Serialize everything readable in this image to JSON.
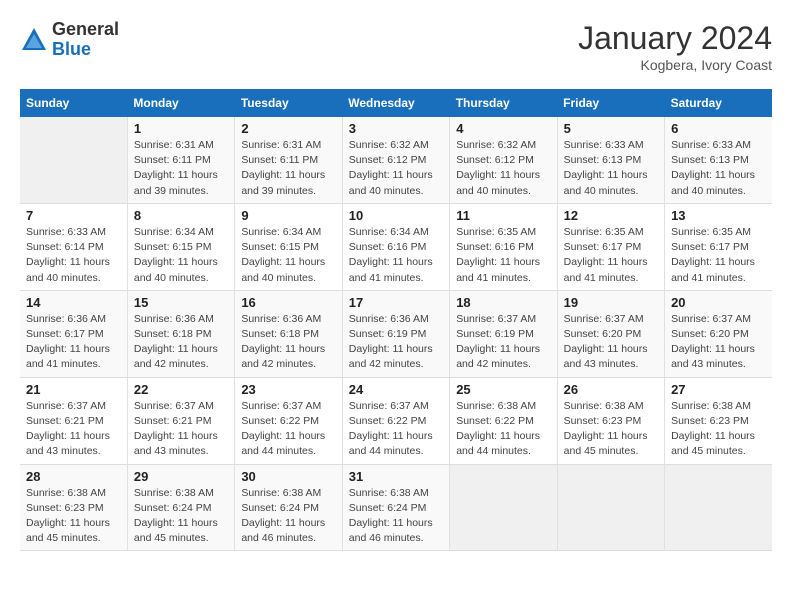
{
  "logo": {
    "general": "General",
    "blue": "Blue"
  },
  "title": "January 2024",
  "location": "Kogbera, Ivory Coast",
  "days_header": [
    "Sunday",
    "Monday",
    "Tuesday",
    "Wednesday",
    "Thursday",
    "Friday",
    "Saturday"
  ],
  "weeks": [
    [
      {
        "num": "",
        "sunrise": "",
        "sunset": "",
        "daylight": ""
      },
      {
        "num": "1",
        "sunrise": "Sunrise: 6:31 AM",
        "sunset": "Sunset: 6:11 PM",
        "daylight": "Daylight: 11 hours and 39 minutes."
      },
      {
        "num": "2",
        "sunrise": "Sunrise: 6:31 AM",
        "sunset": "Sunset: 6:11 PM",
        "daylight": "Daylight: 11 hours and 39 minutes."
      },
      {
        "num": "3",
        "sunrise": "Sunrise: 6:32 AM",
        "sunset": "Sunset: 6:12 PM",
        "daylight": "Daylight: 11 hours and 40 minutes."
      },
      {
        "num": "4",
        "sunrise": "Sunrise: 6:32 AM",
        "sunset": "Sunset: 6:12 PM",
        "daylight": "Daylight: 11 hours and 40 minutes."
      },
      {
        "num": "5",
        "sunrise": "Sunrise: 6:33 AM",
        "sunset": "Sunset: 6:13 PM",
        "daylight": "Daylight: 11 hours and 40 minutes."
      },
      {
        "num": "6",
        "sunrise": "Sunrise: 6:33 AM",
        "sunset": "Sunset: 6:13 PM",
        "daylight": "Daylight: 11 hours and 40 minutes."
      }
    ],
    [
      {
        "num": "7",
        "sunrise": "Sunrise: 6:33 AM",
        "sunset": "Sunset: 6:14 PM",
        "daylight": "Daylight: 11 hours and 40 minutes."
      },
      {
        "num": "8",
        "sunrise": "Sunrise: 6:34 AM",
        "sunset": "Sunset: 6:15 PM",
        "daylight": "Daylight: 11 hours and 40 minutes."
      },
      {
        "num": "9",
        "sunrise": "Sunrise: 6:34 AM",
        "sunset": "Sunset: 6:15 PM",
        "daylight": "Daylight: 11 hours and 40 minutes."
      },
      {
        "num": "10",
        "sunrise": "Sunrise: 6:34 AM",
        "sunset": "Sunset: 6:16 PM",
        "daylight": "Daylight: 11 hours and 41 minutes."
      },
      {
        "num": "11",
        "sunrise": "Sunrise: 6:35 AM",
        "sunset": "Sunset: 6:16 PM",
        "daylight": "Daylight: 11 hours and 41 minutes."
      },
      {
        "num": "12",
        "sunrise": "Sunrise: 6:35 AM",
        "sunset": "Sunset: 6:17 PM",
        "daylight": "Daylight: 11 hours and 41 minutes."
      },
      {
        "num": "13",
        "sunrise": "Sunrise: 6:35 AM",
        "sunset": "Sunset: 6:17 PM",
        "daylight": "Daylight: 11 hours and 41 minutes."
      }
    ],
    [
      {
        "num": "14",
        "sunrise": "Sunrise: 6:36 AM",
        "sunset": "Sunset: 6:17 PM",
        "daylight": "Daylight: 11 hours and 41 minutes."
      },
      {
        "num": "15",
        "sunrise": "Sunrise: 6:36 AM",
        "sunset": "Sunset: 6:18 PM",
        "daylight": "Daylight: 11 hours and 42 minutes."
      },
      {
        "num": "16",
        "sunrise": "Sunrise: 6:36 AM",
        "sunset": "Sunset: 6:18 PM",
        "daylight": "Daylight: 11 hours and 42 minutes."
      },
      {
        "num": "17",
        "sunrise": "Sunrise: 6:36 AM",
        "sunset": "Sunset: 6:19 PM",
        "daylight": "Daylight: 11 hours and 42 minutes."
      },
      {
        "num": "18",
        "sunrise": "Sunrise: 6:37 AM",
        "sunset": "Sunset: 6:19 PM",
        "daylight": "Daylight: 11 hours and 42 minutes."
      },
      {
        "num": "19",
        "sunrise": "Sunrise: 6:37 AM",
        "sunset": "Sunset: 6:20 PM",
        "daylight": "Daylight: 11 hours and 43 minutes."
      },
      {
        "num": "20",
        "sunrise": "Sunrise: 6:37 AM",
        "sunset": "Sunset: 6:20 PM",
        "daylight": "Daylight: 11 hours and 43 minutes."
      }
    ],
    [
      {
        "num": "21",
        "sunrise": "Sunrise: 6:37 AM",
        "sunset": "Sunset: 6:21 PM",
        "daylight": "Daylight: 11 hours and 43 minutes."
      },
      {
        "num": "22",
        "sunrise": "Sunrise: 6:37 AM",
        "sunset": "Sunset: 6:21 PM",
        "daylight": "Daylight: 11 hours and 43 minutes."
      },
      {
        "num": "23",
        "sunrise": "Sunrise: 6:37 AM",
        "sunset": "Sunset: 6:22 PM",
        "daylight": "Daylight: 11 hours and 44 minutes."
      },
      {
        "num": "24",
        "sunrise": "Sunrise: 6:37 AM",
        "sunset": "Sunset: 6:22 PM",
        "daylight": "Daylight: 11 hours and 44 minutes."
      },
      {
        "num": "25",
        "sunrise": "Sunrise: 6:38 AM",
        "sunset": "Sunset: 6:22 PM",
        "daylight": "Daylight: 11 hours and 44 minutes."
      },
      {
        "num": "26",
        "sunrise": "Sunrise: 6:38 AM",
        "sunset": "Sunset: 6:23 PM",
        "daylight": "Daylight: 11 hours and 45 minutes."
      },
      {
        "num": "27",
        "sunrise": "Sunrise: 6:38 AM",
        "sunset": "Sunset: 6:23 PM",
        "daylight": "Daylight: 11 hours and 45 minutes."
      }
    ],
    [
      {
        "num": "28",
        "sunrise": "Sunrise: 6:38 AM",
        "sunset": "Sunset: 6:23 PM",
        "daylight": "Daylight: 11 hours and 45 minutes."
      },
      {
        "num": "29",
        "sunrise": "Sunrise: 6:38 AM",
        "sunset": "Sunset: 6:24 PM",
        "daylight": "Daylight: 11 hours and 45 minutes."
      },
      {
        "num": "30",
        "sunrise": "Sunrise: 6:38 AM",
        "sunset": "Sunset: 6:24 PM",
        "daylight": "Daylight: 11 hours and 46 minutes."
      },
      {
        "num": "31",
        "sunrise": "Sunrise: 6:38 AM",
        "sunset": "Sunset: 6:24 PM",
        "daylight": "Daylight: 11 hours and 46 minutes."
      },
      {
        "num": "",
        "sunrise": "",
        "sunset": "",
        "daylight": ""
      },
      {
        "num": "",
        "sunrise": "",
        "sunset": "",
        "daylight": ""
      },
      {
        "num": "",
        "sunrise": "",
        "sunset": "",
        "daylight": ""
      }
    ]
  ]
}
